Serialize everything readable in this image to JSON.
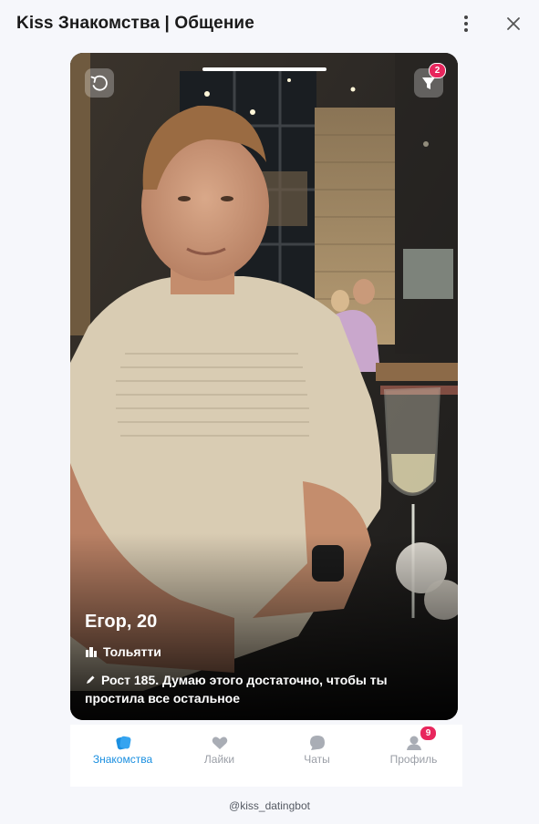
{
  "window": {
    "title": "Kiss Знакомства | Общение",
    "menu_icon": "more-vertical-icon",
    "close_icon": "close-icon"
  },
  "card": {
    "name_age": "Егор, 20",
    "city": "Тольятти",
    "bio": "Рост 185. Думаю этого достаточно, чтобы ты простила все остальное",
    "filter_badge": "2",
    "reset_icon": "undo-icon",
    "filter_icon": "filter-icon",
    "city_icon": "city-icon",
    "bio_icon": "pencil-icon"
  },
  "nav": {
    "items": [
      {
        "label": "Знакомства",
        "icon": "cards-icon",
        "active": true
      },
      {
        "label": "Лайки",
        "icon": "heart-icon",
        "active": false
      },
      {
        "label": "Чаты",
        "icon": "chat-icon",
        "active": false
      },
      {
        "label": "Профиль",
        "icon": "user-icon",
        "active": false,
        "badge": "9"
      }
    ]
  },
  "footer": {
    "handle": "@kiss_datingbot"
  },
  "colors": {
    "accent": "#1a8fe0",
    "badge": "#e8265d",
    "inactive": "#9a9ea6",
    "background": "#f6f7fb"
  }
}
